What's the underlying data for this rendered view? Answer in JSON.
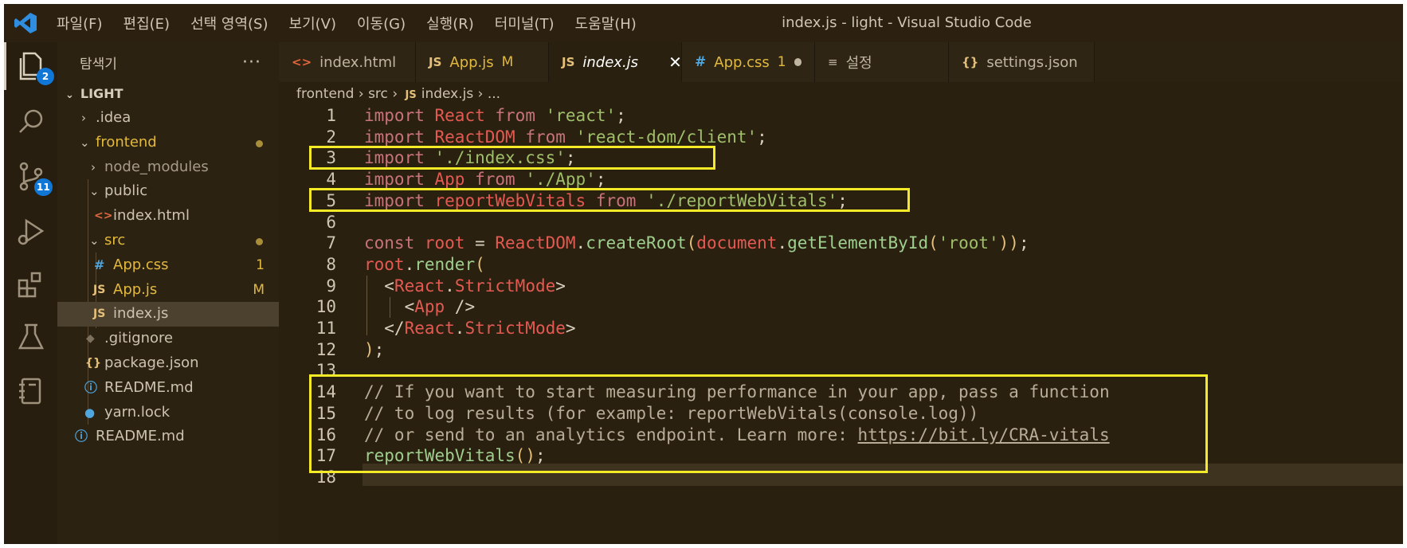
{
  "window": {
    "title": "index.js - light - Visual Studio Code",
    "menu": [
      "파일(F)",
      "편집(E)",
      "선택 영역(S)",
      "보기(V)",
      "이동(G)",
      "실행(R)",
      "터미널(T)",
      "도움말(H)"
    ]
  },
  "activity_bar": {
    "explorer_badge": "2",
    "scm_badge": "11",
    "items": [
      "explorer-icon",
      "search-icon",
      "source-control-icon",
      "run-debug-icon",
      "extensions-icon",
      "testing-icon",
      "notebook-icon"
    ]
  },
  "sidebar": {
    "title": "탐색기",
    "more": "···",
    "section": "LIGHT",
    "tree": [
      {
        "name": ".idea",
        "status": ""
      },
      {
        "name": "frontend",
        "status": "dot"
      },
      {
        "name": "node_modules",
        "status": ""
      },
      {
        "name": "public",
        "status": ""
      },
      {
        "name": "index.html",
        "icon": "<>",
        "status": ""
      },
      {
        "name": "src",
        "status": "dot"
      },
      {
        "name": "App.css",
        "icon": "#",
        "status": "1"
      },
      {
        "name": "App.js",
        "icon": "JS",
        "status": "M"
      },
      {
        "name": "index.js",
        "icon": "JS",
        "status": ""
      },
      {
        "name": ".gitignore",
        "icon": "◆",
        "status": ""
      },
      {
        "name": "package.json",
        "icon": "{}",
        "status": ""
      },
      {
        "name": "README.md",
        "icon": "ⓘ",
        "status": ""
      },
      {
        "name": "yarn.lock",
        "icon": "🐈",
        "status": ""
      },
      {
        "name": "README.md",
        "icon": "ⓘ",
        "status": ""
      }
    ]
  },
  "tabs": [
    {
      "label": "index.html",
      "icon": "<>",
      "status": "dot"
    },
    {
      "label": "App.js",
      "icon": "JS",
      "status": "M"
    },
    {
      "label": "index.js",
      "icon": "JS",
      "status": "close"
    },
    {
      "label": "App.css",
      "icon": "#",
      "status": "1"
    },
    {
      "label": "설정",
      "icon": "≡",
      "status": ""
    },
    {
      "label": "settings.json",
      "icon": "{}",
      "status": ""
    }
  ],
  "breadcrumb": [
    "frontend",
    "src",
    "index.js",
    "..."
  ],
  "editor": {
    "line_numbers": [
      "1",
      "2",
      "3",
      "4",
      "5",
      "6",
      "7",
      "8",
      "9",
      "10",
      "11",
      "12",
      "13",
      "14",
      "15",
      "16",
      "17",
      "18"
    ],
    "lines": [
      "import React from 'react';",
      "import ReactDOM from 'react-dom/client';",
      "import './index.css';",
      "import App from './App';",
      "import reportWebVitals from './reportWebVitals';",
      "",
      "const root = ReactDOM.createRoot(document.getElementById('root'));",
      "root.render(",
      "  <React.StrictMode>",
      "    <App />",
      "  </React.StrictMode>",
      ");",
      "",
      "// If you want to start measuring performance in your app, pass a function",
      "// to log results (for example: reportWebVitals(console.log))",
      "// or send to an analytics endpoint. Learn more: https://bit.ly/CRA-vitals",
      "reportWebVitals();",
      ""
    ]
  },
  "colors": {
    "highlight_box": "#f5ea28",
    "badge": "#1177d6",
    "background": "#2a2010"
  }
}
